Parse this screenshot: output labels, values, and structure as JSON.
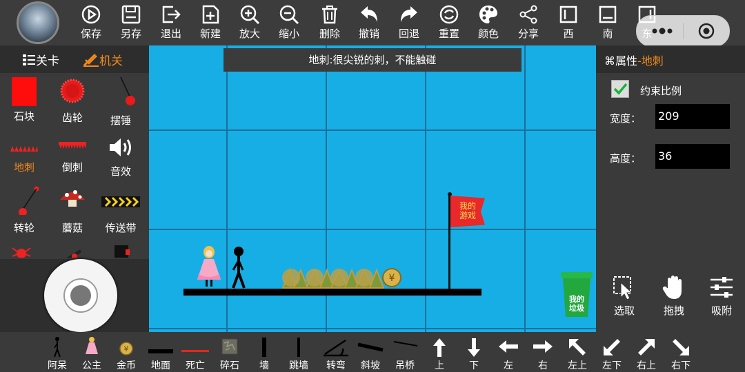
{
  "toolbar": {
    "buttons": [
      {
        "label": "保存",
        "icon": "play-circle-icon"
      },
      {
        "label": "另存",
        "icon": "floppy-icon"
      },
      {
        "label": "退出",
        "icon": "exit-icon"
      },
      {
        "label": "新建",
        "icon": "new-file-icon"
      },
      {
        "label": "放大",
        "icon": "zoom-in-icon"
      },
      {
        "label": "缩小",
        "icon": "zoom-out-icon"
      },
      {
        "label": "删除",
        "icon": "trash-icon"
      },
      {
        "label": "撤销",
        "icon": "undo-icon"
      },
      {
        "label": "回退",
        "icon": "redo-icon"
      },
      {
        "label": "重置",
        "icon": "reset-icon"
      },
      {
        "label": "颜色",
        "icon": "palette-icon"
      },
      {
        "label": "分享",
        "icon": "share-icon"
      },
      {
        "label": "西",
        "icon": "align-west-icon"
      },
      {
        "label": "南",
        "icon": "align-south-icon"
      },
      {
        "label": "东",
        "icon": "align-east-icon"
      }
    ]
  },
  "left_tabs": {
    "levels": "关卡",
    "mechanisms": "机关"
  },
  "palette": [
    {
      "label": "石块",
      "active": false
    },
    {
      "label": "齿轮",
      "active": false
    },
    {
      "label": "摆锤",
      "active": false
    },
    {
      "label": "地刺",
      "active": true
    },
    {
      "label": "倒刺",
      "active": false
    },
    {
      "label": "音效",
      "active": false
    },
    {
      "label": "转轮",
      "active": false
    },
    {
      "label": "蘑菇",
      "active": false
    },
    {
      "label": "传送带",
      "active": false
    }
  ],
  "canvas": {
    "tip": "地刺:很尖锐的刺，不能触碰",
    "flag_text": "我的\n游戏",
    "trash_text": "我的\n垃圾"
  },
  "properties": {
    "title": "属性",
    "object": "-地刺",
    "constrain_label": "约束比例",
    "constrain_checked": true,
    "width_label": "宽度：",
    "width_value": "209",
    "height_label": "高度：",
    "height_value": "36"
  },
  "tools": [
    {
      "label": "选取",
      "icon": "select-cursor-icon"
    },
    {
      "label": "拖拽",
      "icon": "hand-icon"
    },
    {
      "label": "吸附",
      "icon": "sliders-icon"
    }
  ],
  "bottom_items": [
    "阿呆",
    "公主",
    "金币",
    "地面",
    "死亡",
    "碎石",
    "墙",
    "跳墙",
    "转弯",
    "斜坡",
    "吊桥",
    "上",
    "下",
    "左",
    "右",
    "左上",
    "左下",
    "右上",
    "右下"
  ],
  "colors": {
    "sky": "#17aee5",
    "accent": "#f08a1c",
    "panel": "#3a3a3a",
    "death_line": "#e0281e"
  }
}
